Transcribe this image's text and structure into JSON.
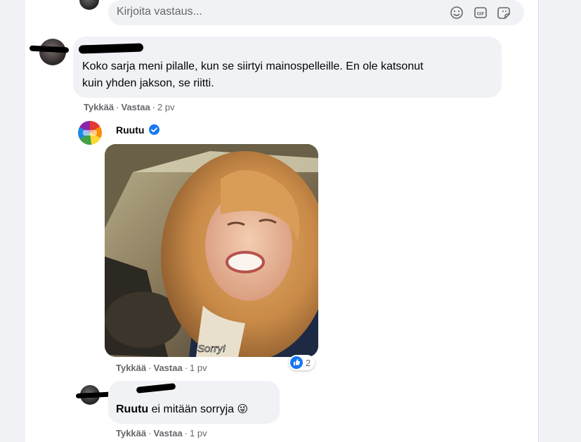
{
  "reply_box": {
    "placeholder": "Kirjoita vastaus...",
    "icons": [
      "emoji-icon",
      "gif-icon",
      "sticker-icon"
    ]
  },
  "comments": [
    {
      "author_name": "",
      "text_line1": "Koko sarja meni pilalle, kun se siirtyi mainospelleille. En ole katsonut",
      "text_line2": "kuin yhden jakson, se riitti.",
      "like_label": "Tykkää",
      "reply_label": "Vastaa",
      "time": "2 pv"
    },
    {
      "author_name": "Ruutu",
      "verified": true,
      "media": "gif",
      "gif_caption": "Sorry!",
      "like_label": "Tykkää",
      "reply_label": "Vastaa",
      "time": "1 pv",
      "reaction_count": "2",
      "reaction_type": "like-icon"
    },
    {
      "author_name": "",
      "mention": "Ruutu",
      "text": " ei mitään sorryja",
      "emoji": "😜",
      "like_label": "Tykkää",
      "reply_label": "Vastaa",
      "time": "1 pv"
    }
  ],
  "colors": {
    "background": "#f0f2f5",
    "panel": "#ffffff",
    "bubble": "#f0f2f5",
    "secondary_text": "#65676b",
    "facebook_blue": "#1877f2"
  },
  "separator": "·"
}
